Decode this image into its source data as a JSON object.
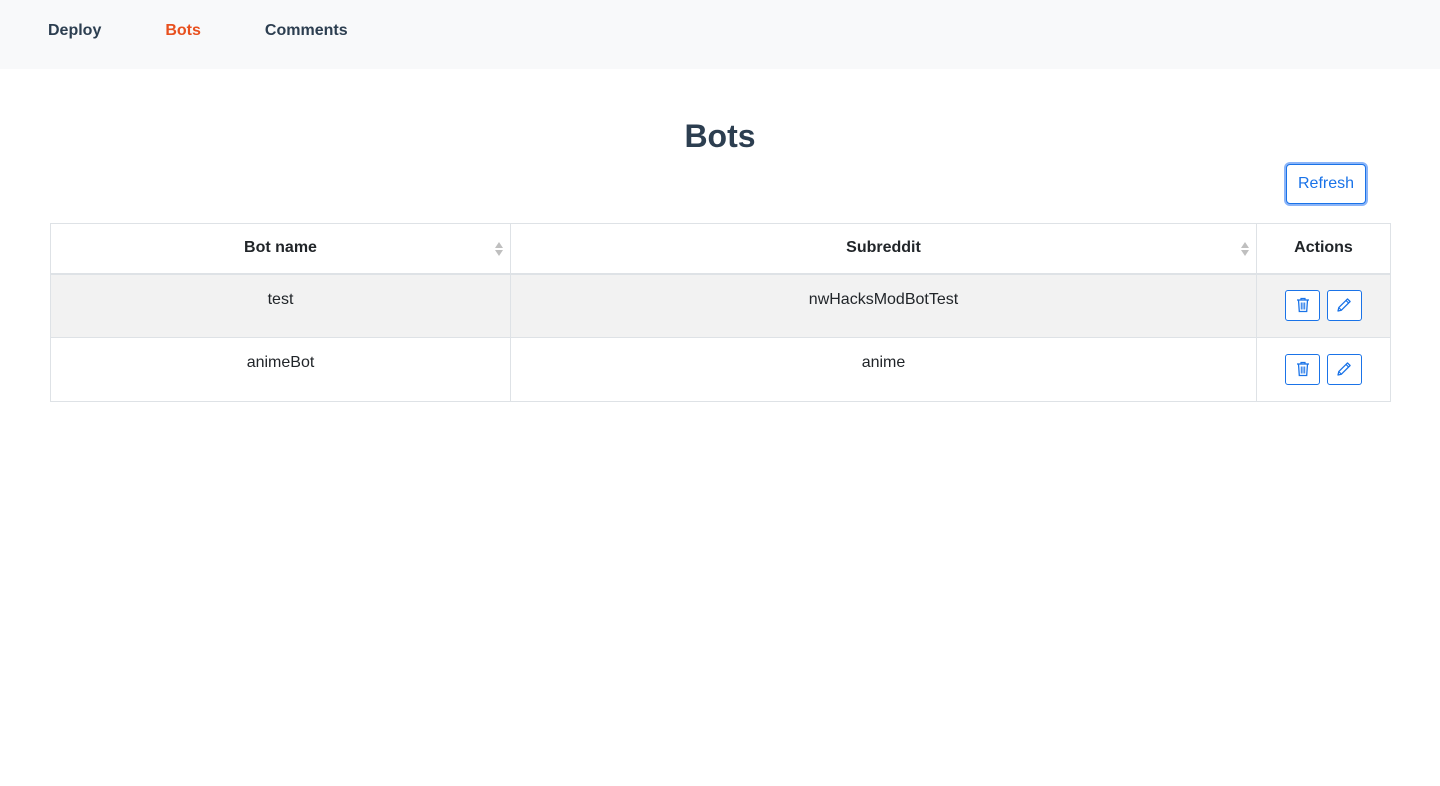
{
  "nav": {
    "items": [
      {
        "label": "Deploy"
      },
      {
        "label": "Bots"
      },
      {
        "label": "Comments"
      }
    ],
    "active": "Bots"
  },
  "page": {
    "title": "Bots",
    "refresh_label": "Refresh"
  },
  "table": {
    "headers": {
      "bot_name": "Bot name",
      "subreddit": "Subreddit",
      "actions": "Actions"
    },
    "rows": [
      {
        "bot_name": "test",
        "subreddit": "nwHacksModBotTest"
      },
      {
        "bot_name": "animeBot",
        "subreddit": "anime"
      }
    ]
  },
  "icons": {
    "sort": "sort-icon",
    "delete": "trash-icon",
    "edit": "pencil-icon"
  },
  "colors": {
    "accent": "#e8501e",
    "primary": "#1a73e8",
    "text": "#2c3e50"
  }
}
